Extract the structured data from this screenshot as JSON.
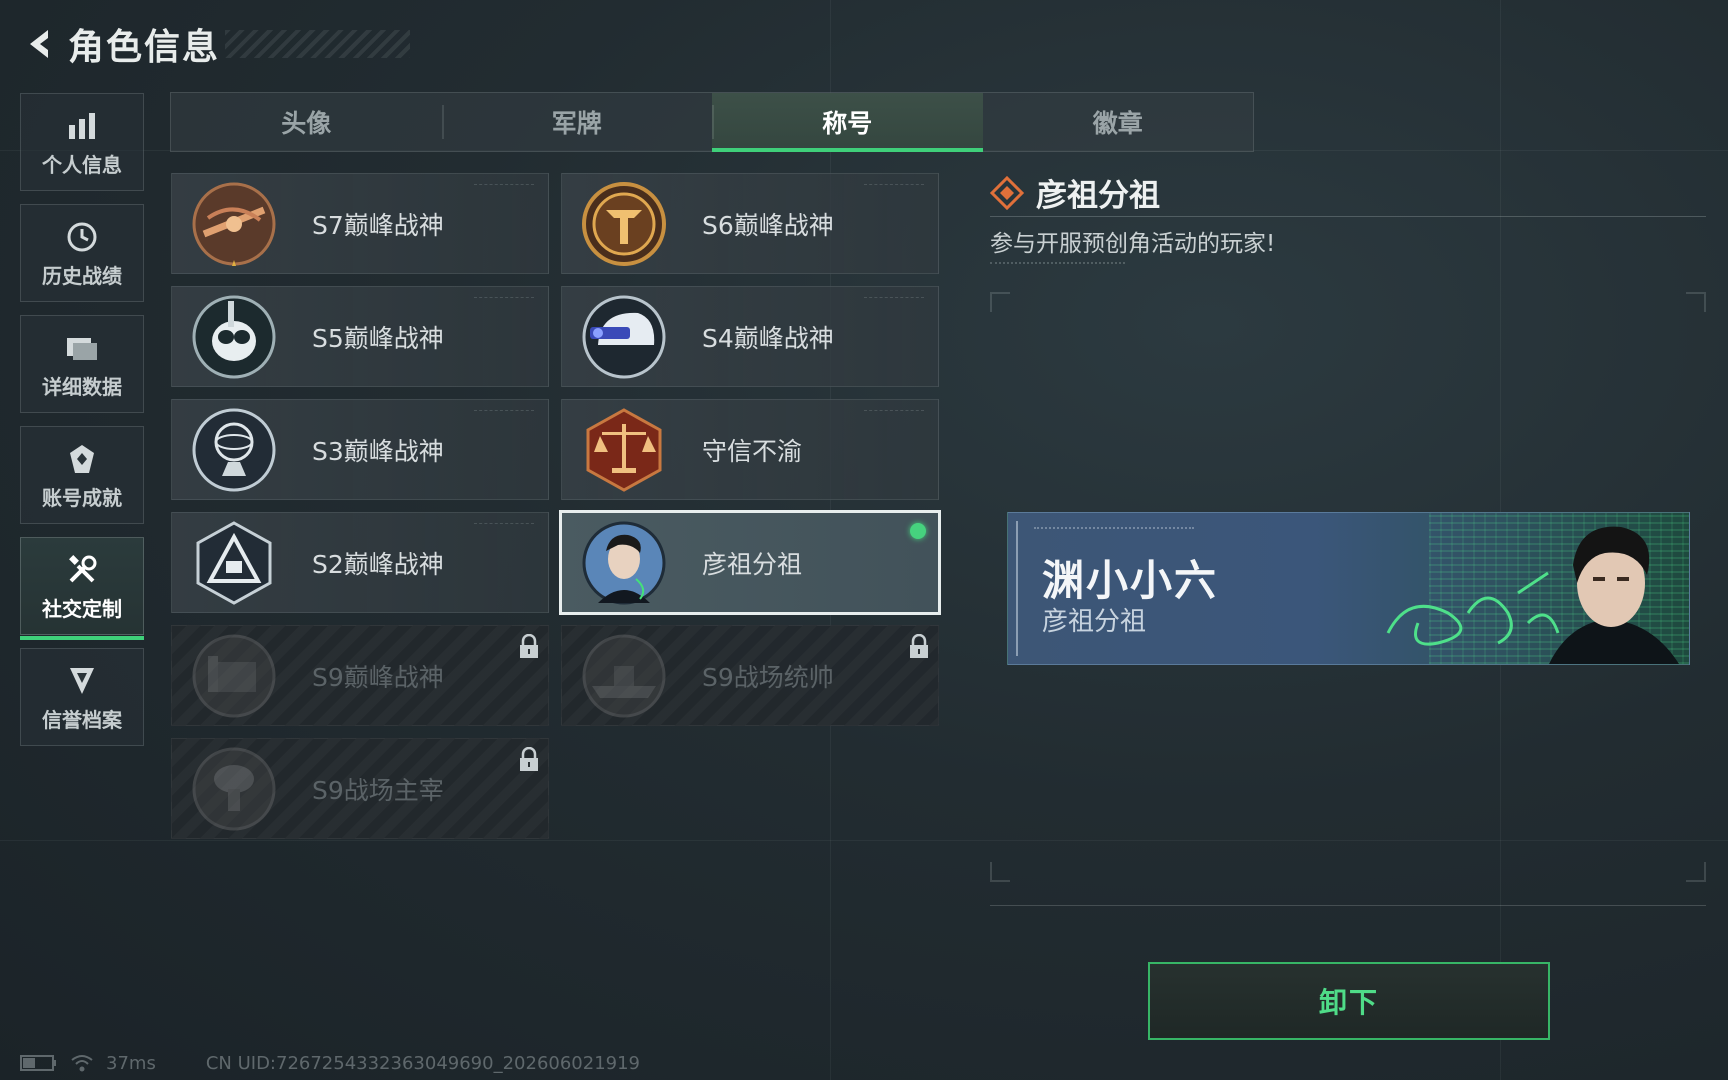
{
  "header": {
    "title": "角色信息"
  },
  "sidebar": {
    "items": [
      {
        "label": "个人信息",
        "icon": "bar-chart-icon"
      },
      {
        "label": "历史战绩",
        "icon": "clock-icon"
      },
      {
        "label": "详细数据",
        "icon": "folder-icon"
      },
      {
        "label": "账号成就",
        "icon": "achievement-icon"
      },
      {
        "label": "社交定制",
        "icon": "tools-icon",
        "active": true
      },
      {
        "label": "信誉档案",
        "icon": "shield-icon"
      }
    ]
  },
  "tabs": [
    {
      "label": "头像"
    },
    {
      "label": "军牌"
    },
    {
      "label": "称号",
      "active": true
    },
    {
      "label": "徽章"
    }
  ],
  "titles": [
    {
      "label": "S7巅峰战神",
      "locked": false,
      "badge": "crossbow-badge-icon"
    },
    {
      "label": "S6巅峰战神",
      "locked": false,
      "badge": "emblem-t-badge-icon"
    },
    {
      "label": "S5巅峰战神",
      "locked": false,
      "badge": "skull-badge-icon"
    },
    {
      "label": "S4巅峰战神",
      "locked": false,
      "badge": "helmet-badge-icon"
    },
    {
      "label": "S3巅峰战神",
      "locked": false,
      "badge": "globe-badge-icon"
    },
    {
      "label": "守信不渝",
      "locked": false,
      "badge": "scales-badge-icon"
    },
    {
      "label": "S2巅峰战神",
      "locked": false,
      "badge": "triangle-badge-icon"
    },
    {
      "label": "彦祖分祖",
      "locked": false,
      "selected": true,
      "badge": "portrait-badge-icon"
    },
    {
      "label": "S9巅峰战神",
      "locked": true,
      "badge": "fortress-badge-icon"
    },
    {
      "label": "S9战场统帅",
      "locked": true,
      "badge": "warship-badge-icon"
    },
    {
      "label": "S9战场主宰",
      "locked": true,
      "badge": "mushroom-cloud-badge-icon"
    }
  ],
  "detail": {
    "title": "彦祖分祖",
    "description": "参与开服预创角活动的玩家!",
    "banner": {
      "player_name": "渊小小六",
      "title": "彦祖分祖"
    },
    "unequip_label": "卸下"
  },
  "status": {
    "ping": "37ms",
    "uid": "CN UID:7267254332363049690_202606021919"
  },
  "colors": {
    "accent_green": "#3fd07a",
    "title_icon_orange": "#e0703a",
    "background": "#222c31"
  }
}
